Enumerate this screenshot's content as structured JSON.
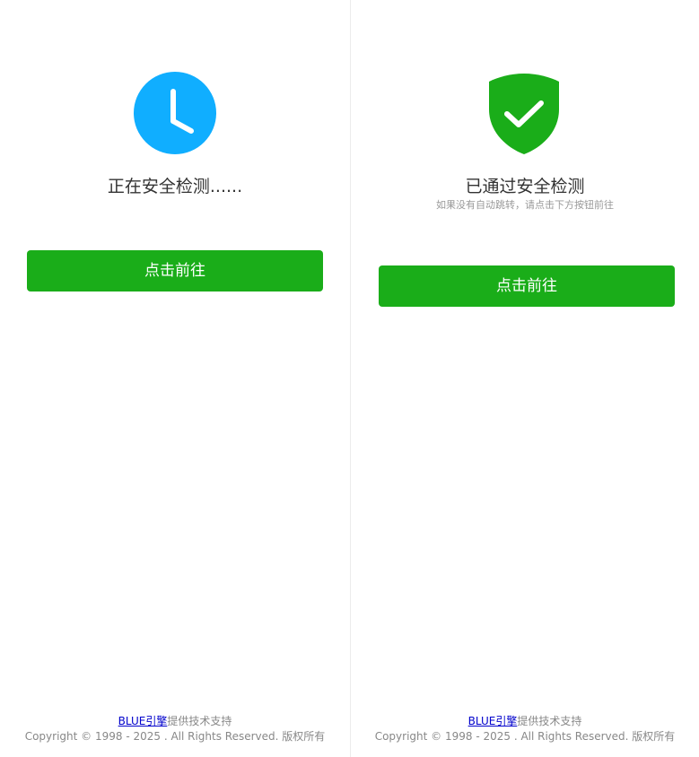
{
  "left_panel": {
    "icon": "clock-icon",
    "icon_color": "#10aeff",
    "title": "正在安全检测......",
    "button_label": "点击前往",
    "footer": {
      "link_text": "BLUE引擎",
      "support_text": "提供技术支持",
      "copyright": "Copyright © 1998 - 2025 . All Rights Reserved. 版权所有"
    }
  },
  "right_panel": {
    "icon": "shield-check-icon",
    "icon_color": "#1aad19",
    "title": "已通过安全检测",
    "subtitle": "如果没有自动跳转，请点击下方按钮前往",
    "button_label": "点击前往",
    "footer": {
      "link_text": "BLUE引擎",
      "support_text": "提供技术支持",
      "copyright": "Copyright © 1998 - 2025 . All Rights Reserved. 版权所有"
    }
  },
  "colors": {
    "button_bg": "#1aad19",
    "button_text": "#ffffff",
    "title_text": "#333333",
    "subtitle_text": "#999999",
    "footer_text": "#888888",
    "link_text": "#0000cc"
  }
}
